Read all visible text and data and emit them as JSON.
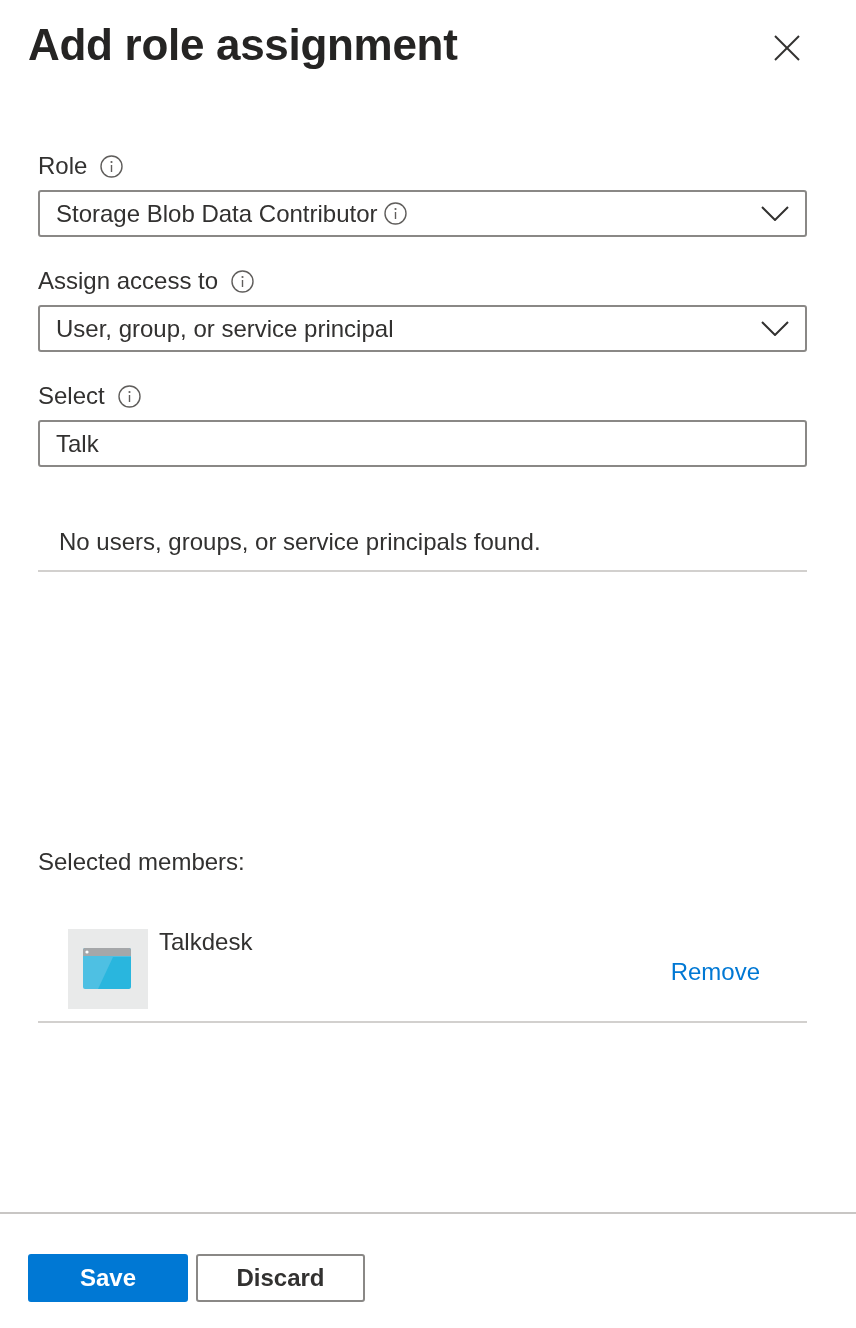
{
  "panel": {
    "title": "Add role assignment"
  },
  "fields": [
    {
      "kind": "dropdown",
      "label": "Role",
      "info": true,
      "value": "Storage Blob Data Contributor",
      "value_info": true
    },
    {
      "kind": "dropdown",
      "label": "Assign access to",
      "info": true,
      "value": "User, group, or service principal",
      "value_info": false
    },
    {
      "kind": "text",
      "label": "Select",
      "info": true,
      "value": "Talk"
    }
  ],
  "search_results": {
    "message": "No users, groups, or service principals found."
  },
  "selected_members": {
    "label": "Selected members:",
    "members": [
      {
        "name": "Talkdesk",
        "action": "Remove"
      }
    ]
  },
  "buttons": [
    {
      "kind": "primary",
      "label": "Save"
    },
    {
      "kind": "secondary",
      "label": "Discard"
    }
  ]
}
